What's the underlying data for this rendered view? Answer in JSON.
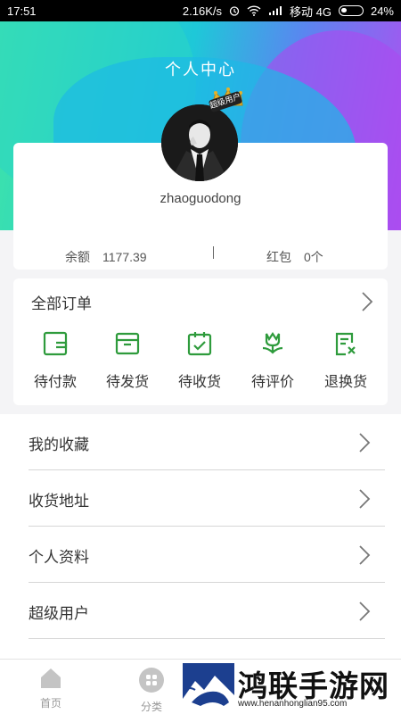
{
  "status_bar": {
    "time": "17:51",
    "speed": "2.16K/s",
    "carrier": "移动 4G",
    "battery": "24%"
  },
  "header": {
    "title": "个人中心"
  },
  "profile": {
    "crown_tag": "超级用户",
    "username": "zhaoguodong",
    "balance_label": "余额",
    "balance_value": "1177.39",
    "redpack_label": "红包",
    "redpack_value": "0个"
  },
  "orders": {
    "title": "全部订单",
    "items": [
      {
        "label": "待付款",
        "icon": "wallet-icon"
      },
      {
        "label": "待发货",
        "icon": "box-icon"
      },
      {
        "label": "待收货",
        "icon": "calendar-check-icon"
      },
      {
        "label": "待评价",
        "icon": "flower-icon"
      },
      {
        "label": "退换货",
        "icon": "return-doc-icon"
      }
    ],
    "icon_color": "#2e9b3c"
  },
  "menu": {
    "items": [
      {
        "label": "我的收藏"
      },
      {
        "label": "收货地址"
      },
      {
        "label": "个人资料"
      },
      {
        "label": "超级用户"
      }
    ]
  },
  "tabbar": {
    "items": [
      {
        "label": "首页",
        "icon": "home-icon"
      },
      {
        "label": "分类",
        "icon": "category-icon"
      }
    ]
  },
  "watermark": {
    "title": "鸿联手游网",
    "url": "www.henanhonglian95.com"
  }
}
